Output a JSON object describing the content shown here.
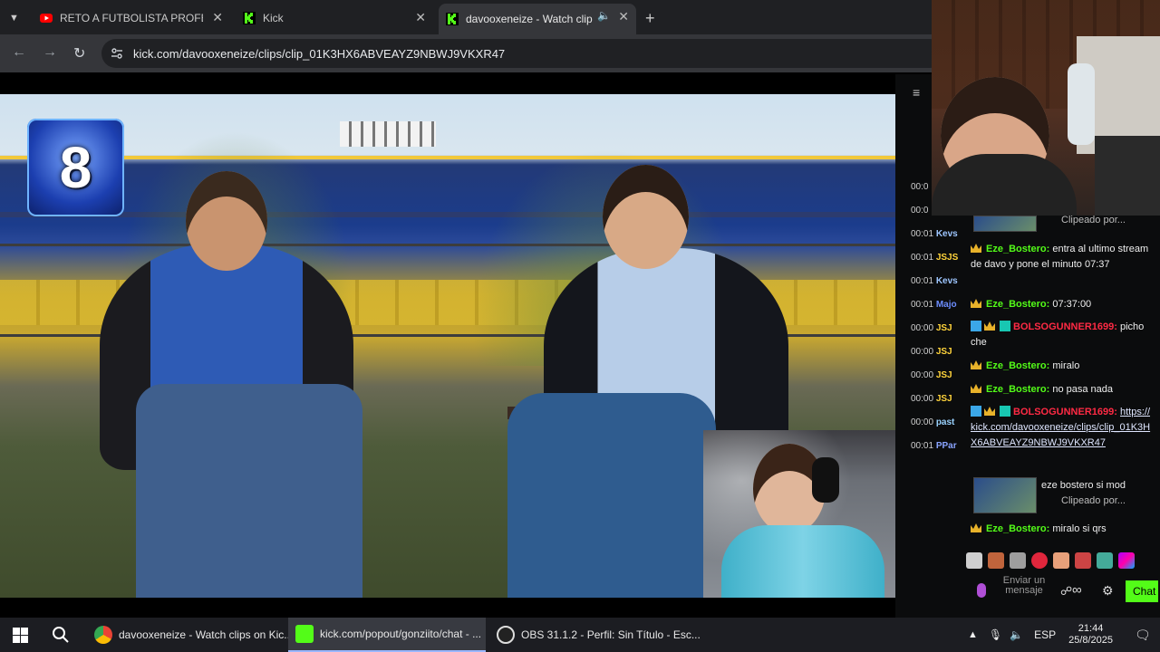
{
  "browser": {
    "tabs": [
      {
        "title": "RETO A FUTBOLISTA PROFESIO",
        "favicon": "youtube-icon"
      },
      {
        "title": "Kick",
        "favicon": "kick-icon"
      },
      {
        "title": "davooxeneize - Watch clips",
        "favicon": "kick-icon"
      }
    ],
    "url": "kick.com/davooxeneize/clips/clip_01K3HX6ABVEAYZ9NBWJ9VKXR47"
  },
  "video": {
    "logo_number": "8"
  },
  "chat": {
    "timestamps": [
      {
        "time": "00:0",
        "user": ""
      },
      {
        "time": "00:0",
        "user": ""
      },
      {
        "time": "00:01",
        "user": "Kevs"
      },
      {
        "time": "00:01",
        "user": "JSJS"
      },
      {
        "time": "00:01",
        "user": "Kevs"
      },
      {
        "time": "00:01",
        "user": "Majo"
      },
      {
        "time": "00:00",
        "user": "JSJ"
      },
      {
        "time": "00:00",
        "user": "JSJ"
      },
      {
        "time": "00:00",
        "user": "JSJ"
      },
      {
        "time": "00:00",
        "user": "JSJ"
      },
      {
        "time": "00:00",
        "user": "past"
      },
      {
        "time": "00:01",
        "user": "PPar"
      }
    ],
    "clip_top_sub": "Clipeado por...",
    "messages": [
      {
        "user": "Eze_Bostero:",
        "text": "entra al ultimo stream de davo y pone el minuto 07:37"
      },
      {
        "user": "Eze_Bostero:",
        "text": "07:37:00"
      },
      {
        "user": "BOLSOGUNNER1699:",
        "text": "picho che"
      },
      {
        "user": "Eze_Bostero:",
        "text": "miralo"
      },
      {
        "user": "Eze_Bostero:",
        "text": "no pasa nada"
      },
      {
        "user": "BOLSOGUNNER1699:",
        "text": "https://kick.com/davooxeneize/clips/clip_01K3HX6ABVEAYZ9NBWJ9VKXR47"
      },
      {
        "user": "Eze_Bostero:",
        "text": "miralo si qrs"
      }
    ],
    "clip_card": {
      "title": "eze bostero si mod",
      "sub": "Clipeado por..."
    },
    "input_placeholder": "Enviar un mensaje",
    "send_label": "Chat"
  },
  "taskbar": {
    "items": [
      {
        "label": "davooxeneize - Watch clips on Kic...",
        "icon": "chrome-icon"
      },
      {
        "label": "kick.com/popout/gonziito/chat - ...",
        "icon": "kick-icon"
      },
      {
        "label": "OBS 31.1.2 - Perfil: Sin Título - Esc...",
        "icon": "obs-icon"
      }
    ],
    "lang": "ESP",
    "time": "21:44",
    "date": "25/8/2025"
  },
  "colors": {
    "kick_green": "#53fc18",
    "chat_red": "#ff2a44",
    "taskbar_bg": "#1c1d22"
  }
}
